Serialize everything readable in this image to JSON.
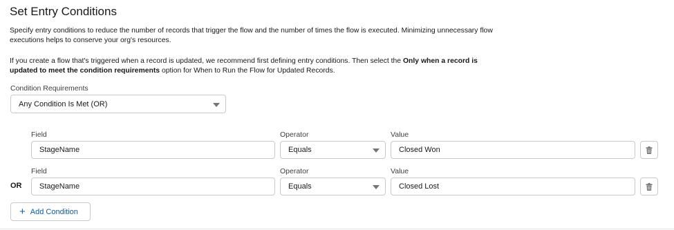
{
  "header": {
    "title": "Set Entry Conditions",
    "paragraph1": "Specify entry conditions to reduce the number of records that trigger the flow and the number of times the flow is executed. Minimizing unnecessary flow executions helps to conserve your org's resources.",
    "paragraph2_part1": "If you create a flow that's triggered when a record is updated, we recommend first defining entry conditions. Then select the ",
    "paragraph2_bold": "Only when a record is updated to meet the condition requirements",
    "paragraph2_part2": " option for When to Run the Flow for Updated Records."
  },
  "condition_requirements": {
    "label": "Condition Requirements",
    "selected": "Any Condition Is Met (OR)"
  },
  "conditions": [
    {
      "prefix": "",
      "field_label": "Field",
      "field_value": "StageName",
      "operator_label": "Operator",
      "operator_value": "Equals",
      "value_label": "Value",
      "value_value": "Closed Won"
    },
    {
      "prefix": "OR",
      "field_label": "Field",
      "field_value": "StageName",
      "operator_label": "Operator",
      "operator_value": "Equals",
      "value_label": "Value",
      "value_value": "Closed Lost"
    }
  ],
  "add_condition": {
    "label": "Add Condition",
    "icon": "plus-icon"
  },
  "icons": {
    "delete": "trash-icon",
    "dropdown": "chevron-down-icon"
  },
  "colors": {
    "link_blue": "#0b5cab",
    "border": "#c9c9c9",
    "text": "#181818"
  }
}
